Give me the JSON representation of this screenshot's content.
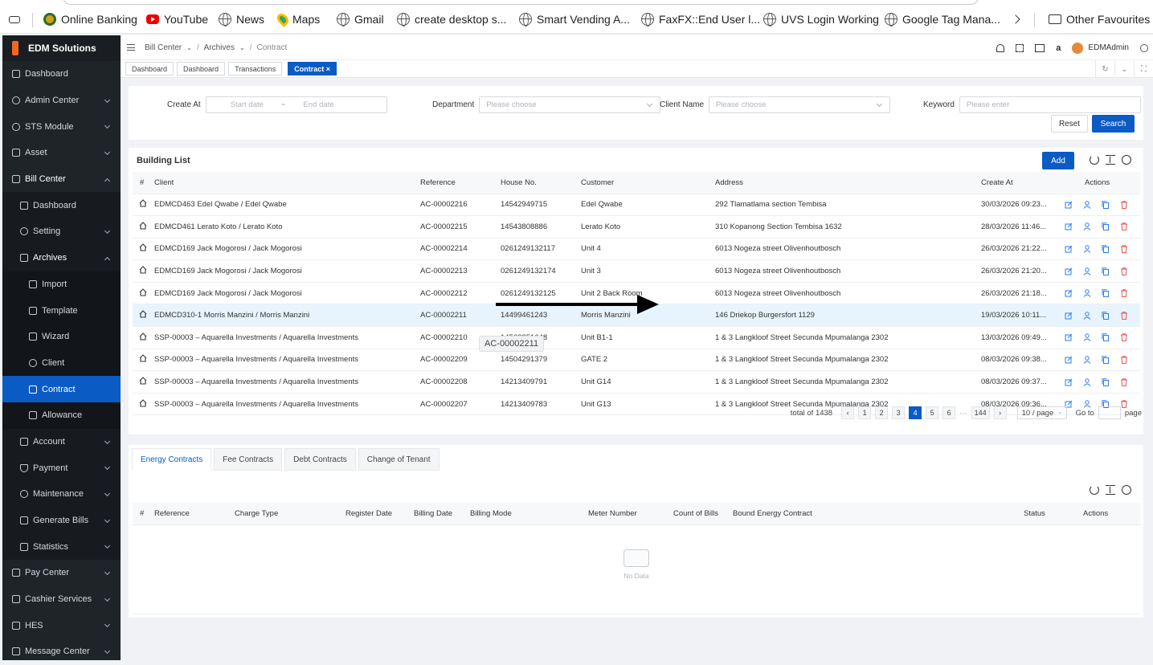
{
  "bookmarks": {
    "items": [
      "Online Banking",
      "YouTube",
      "News",
      "Maps",
      "Gmail",
      "create desktop s...",
      "Smart Vending A...",
      "FaxFX::End User l...",
      "UVS Login Working",
      "Google Tag Mana..."
    ],
    "other": "Other Favourites"
  },
  "sidebar": {
    "brand": "EDM Solutions",
    "items": [
      {
        "label": "Dashboard"
      },
      {
        "label": "Admin Center"
      },
      {
        "label": "STS Module"
      },
      {
        "label": "Asset"
      },
      {
        "label": "Bill Center"
      },
      {
        "label": "Dashboard"
      },
      {
        "label": "Setting"
      },
      {
        "label": "Archives"
      },
      {
        "label": "Import"
      },
      {
        "label": "Template"
      },
      {
        "label": "Wizard"
      },
      {
        "label": "Client"
      },
      {
        "label": "Contract"
      },
      {
        "label": "Allowance"
      },
      {
        "label": "Account"
      },
      {
        "label": "Payment"
      },
      {
        "label": "Maintenance"
      },
      {
        "label": "Generate Bills"
      },
      {
        "label": "Statistics"
      },
      {
        "label": "Pay Center"
      },
      {
        "label": "Cashier Services"
      },
      {
        "label": "HES"
      },
      {
        "label": "Message Center"
      }
    ]
  },
  "header": {
    "breadcrumb": [
      "Bill Center",
      "Archives",
      "Contract"
    ],
    "user": "EDMAdmin"
  },
  "tabs": [
    "Dashboard",
    "Dashboard",
    "Transactions",
    "Contract ×"
  ],
  "filters": {
    "create_at_label": "Create At",
    "start_placeholder": "Start date",
    "range_sep": "~",
    "end_placeholder": "End date",
    "department_label": "Department",
    "department_placeholder": "Please choose",
    "client_label": "Client Name",
    "client_placeholder": "Please choose",
    "keyword_label": "Keyword",
    "keyword_placeholder": "Please enter",
    "reset": "Reset",
    "search": "Search"
  },
  "building": {
    "title": "Building List",
    "add": "Add",
    "columns": [
      "#",
      "Client",
      "Reference",
      "House No.",
      "Customer",
      "Address",
      "Create At",
      "Actions"
    ],
    "rows": [
      {
        "client": "EDMCD463 Edel Qwabe / Edel Qwabe",
        "ref": "AC-00002216",
        "house": "14542949715",
        "customer": "Edel Qwabe",
        "address": "292 Tlamatlama section Tembisa",
        "created": "30/03/2026 09:23..."
      },
      {
        "client": "EDMCD461 Lerato Koto / Lerato Koto",
        "ref": "AC-00002215",
        "house": "14543808886",
        "customer": "Lerato Koto",
        "address": "310 Kopanong Section Tembisa 1632",
        "created": "28/03/2026 11:46..."
      },
      {
        "client": "EDMCD169 Jack Mogorosi / Jack Mogorosi",
        "ref": "AC-00002214",
        "house": "0261249132117",
        "customer": "Unit 4",
        "address": "6013 Nogeza street Olivenhoutbosch",
        "created": "26/03/2026 21:22..."
      },
      {
        "client": "EDMCD169 Jack Mogorosi / Jack Mogorosi",
        "ref": "AC-00002213",
        "house": "0261249132174",
        "customer": "Unit 3",
        "address": "6013 Nogeza street Olivenhoutbosch",
        "created": "26/03/2026 21:20..."
      },
      {
        "client": "EDMCD169 Jack Mogorosi / Jack Mogorosi",
        "ref": "AC-00002212",
        "house": "0261249132125",
        "customer": "Unit 2 Back Room",
        "address": "6013 Nogeza street Olivenhoutbosch",
        "created": "26/03/2026 21:18..."
      },
      {
        "client": "EDMCD310-1 Morris Manzini / Morris Manzini",
        "ref": "AC-00002211",
        "house": "14499461243",
        "customer": "Morris Manzini",
        "address": "146 Driekop Burgersfort 1129",
        "created": "19/03/2026 10:11..."
      },
      {
        "client": "SSP-00003 – Aquarella Investments / Aquarella Investments",
        "ref": "AC-00002210",
        "house": "14509251648",
        "customer": "Unit B1-1",
        "address": "1 & 3 Langkloof Street Secunda Mpumalanga 2302",
        "created": "13/03/2026 09:49..."
      },
      {
        "client": "SSP-00003 – Aquarella Investments / Aquarella Investments",
        "ref": "AC-00002209",
        "house": "14504291379",
        "customer": "GATE 2",
        "address": "1 & 3 Langkloof Street Secunda Mpumalanga 2302",
        "created": "08/03/2026 09:38..."
      },
      {
        "client": "SSP-00003 – Aquarella Investments / Aquarella Investments",
        "ref": "AC-00002208",
        "house": "14213409791",
        "customer": "Unit G14",
        "address": "1 & 3 Langkloof Street Secunda Mpumalanga 2302",
        "created": "08/03/2026 09:37..."
      },
      {
        "client": "SSP-00003 – Aquarella Investments / Aquarella Investments",
        "ref": "AC-00002207",
        "house": "14213409783",
        "customer": "Unit G13",
        "address": "1 & 3 Langkloof Street Secunda Mpumalanga 2302",
        "created": "08/03/2026 09:36..."
      }
    ],
    "pager": {
      "total": "total of 1438",
      "pages": [
        "1",
        "2",
        "3",
        "4",
        "5",
        "6",
        "···",
        "144"
      ],
      "current": "4",
      "size": "10 / page",
      "goto": "Go to",
      "page_word": "page"
    }
  },
  "tooltip": "AC-00002211",
  "bottom": {
    "tabs": [
      "Energy Contracts",
      "Fee Contracts",
      "Debt Contracts",
      "Change of Tenant"
    ],
    "columns": [
      "#",
      "Reference",
      "Charge Type",
      "Register Date",
      "Billing Date",
      "Billing Mode",
      "Meter Number",
      "Count of Bills",
      "Bound Energy Contract",
      "Status",
      "Actions"
    ],
    "empty": "No Data"
  },
  "colors": {
    "accent": "#0a5bc4",
    "sidebar": "#1f2429",
    "highlight": "#e8f4fd",
    "danger": "#e55353"
  }
}
